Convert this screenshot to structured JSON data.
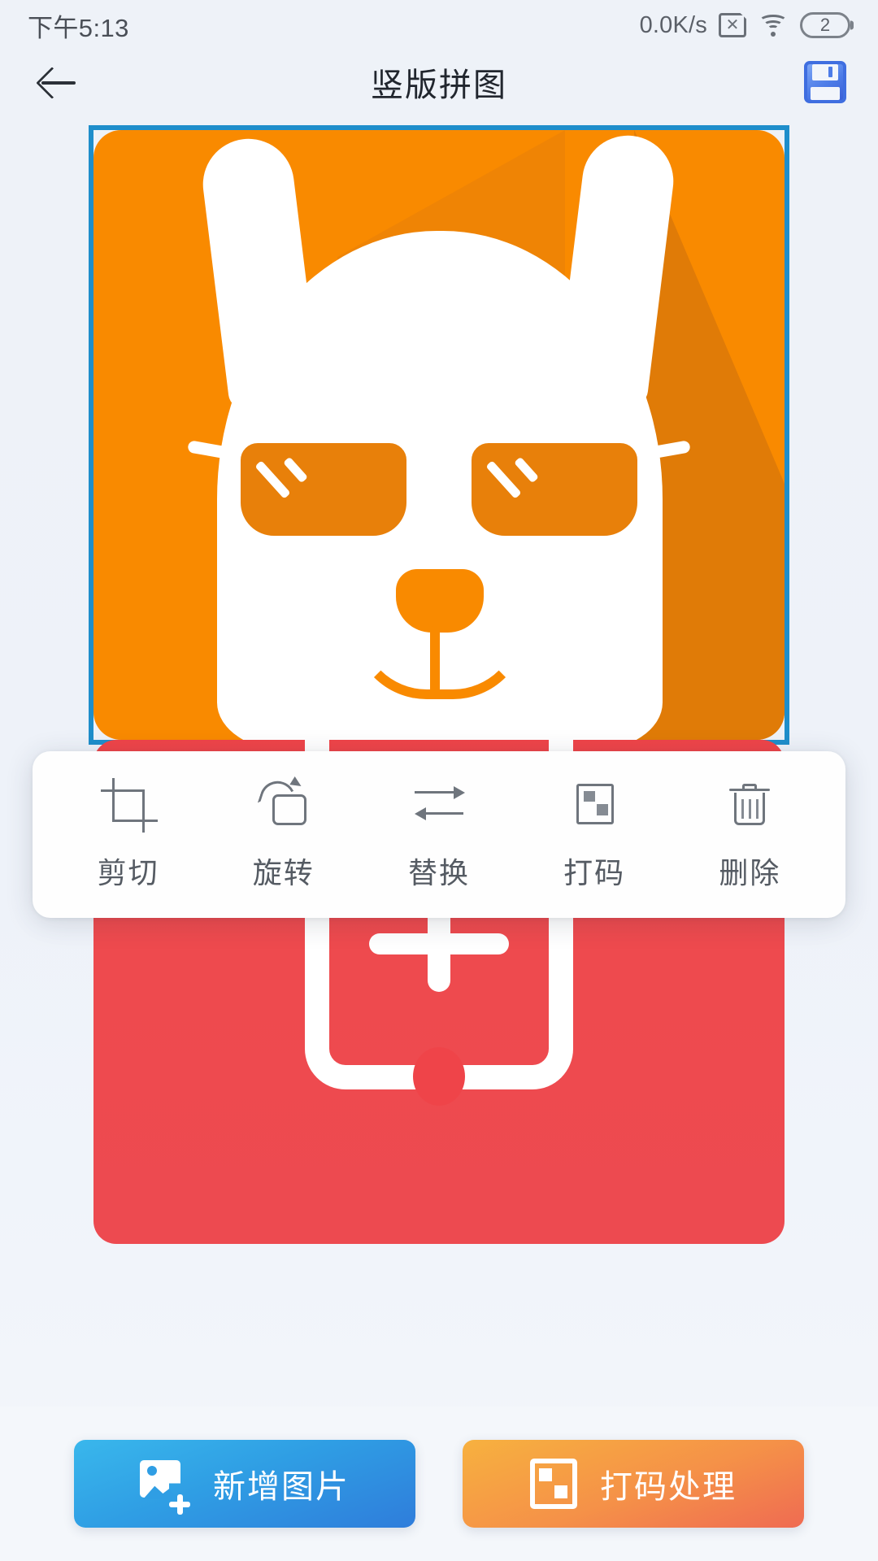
{
  "status_bar": {
    "time": "下午5:13",
    "network_speed": "0.0K/s",
    "sim_icon": "sim-card-disabled-icon",
    "wifi_icon": "wifi-icon",
    "battery_level": "2",
    "battery_icon": "battery-icon"
  },
  "header": {
    "back_icon": "back-arrow-icon",
    "title": "竖版拼图",
    "save_icon": "floppy-save-icon"
  },
  "canvas": {
    "selected_index": 0,
    "photos": [
      {
        "name": "llama-app-icon",
        "selected": true,
        "bg_color": "#f98a00",
        "shadow_color": "#e07b07",
        "accent_color": "#e8800a"
      },
      {
        "name": "payment-app-icon",
        "selected": false,
        "bg_color": "#ef4449",
        "symbol": "¥"
      }
    ]
  },
  "toolbar": {
    "items": [
      {
        "label": "剪切",
        "icon": "crop-icon"
      },
      {
        "label": "旋转",
        "icon": "rotate-icon"
      },
      {
        "label": "替换",
        "icon": "replace-icon"
      },
      {
        "label": "打码",
        "icon": "mosaic-icon"
      },
      {
        "label": "删除",
        "icon": "trash-icon"
      }
    ]
  },
  "bottom_bar": {
    "add_image": {
      "label": "新增图片",
      "icon": "add-image-icon",
      "color_start": "#39b7ec",
      "color_end": "#2f7ddb"
    },
    "mosaic_process": {
      "label": "打码处理",
      "icon": "mosaic-icon",
      "color_start": "#f7b13f",
      "color_end": "#ef6b52"
    }
  },
  "colors": {
    "page_background": "#eef2f8",
    "selection_border": "#1e8ecb",
    "toolbar_background": "#fefefe",
    "toolbar_text": "#555b63",
    "title_text": "#21262e"
  }
}
